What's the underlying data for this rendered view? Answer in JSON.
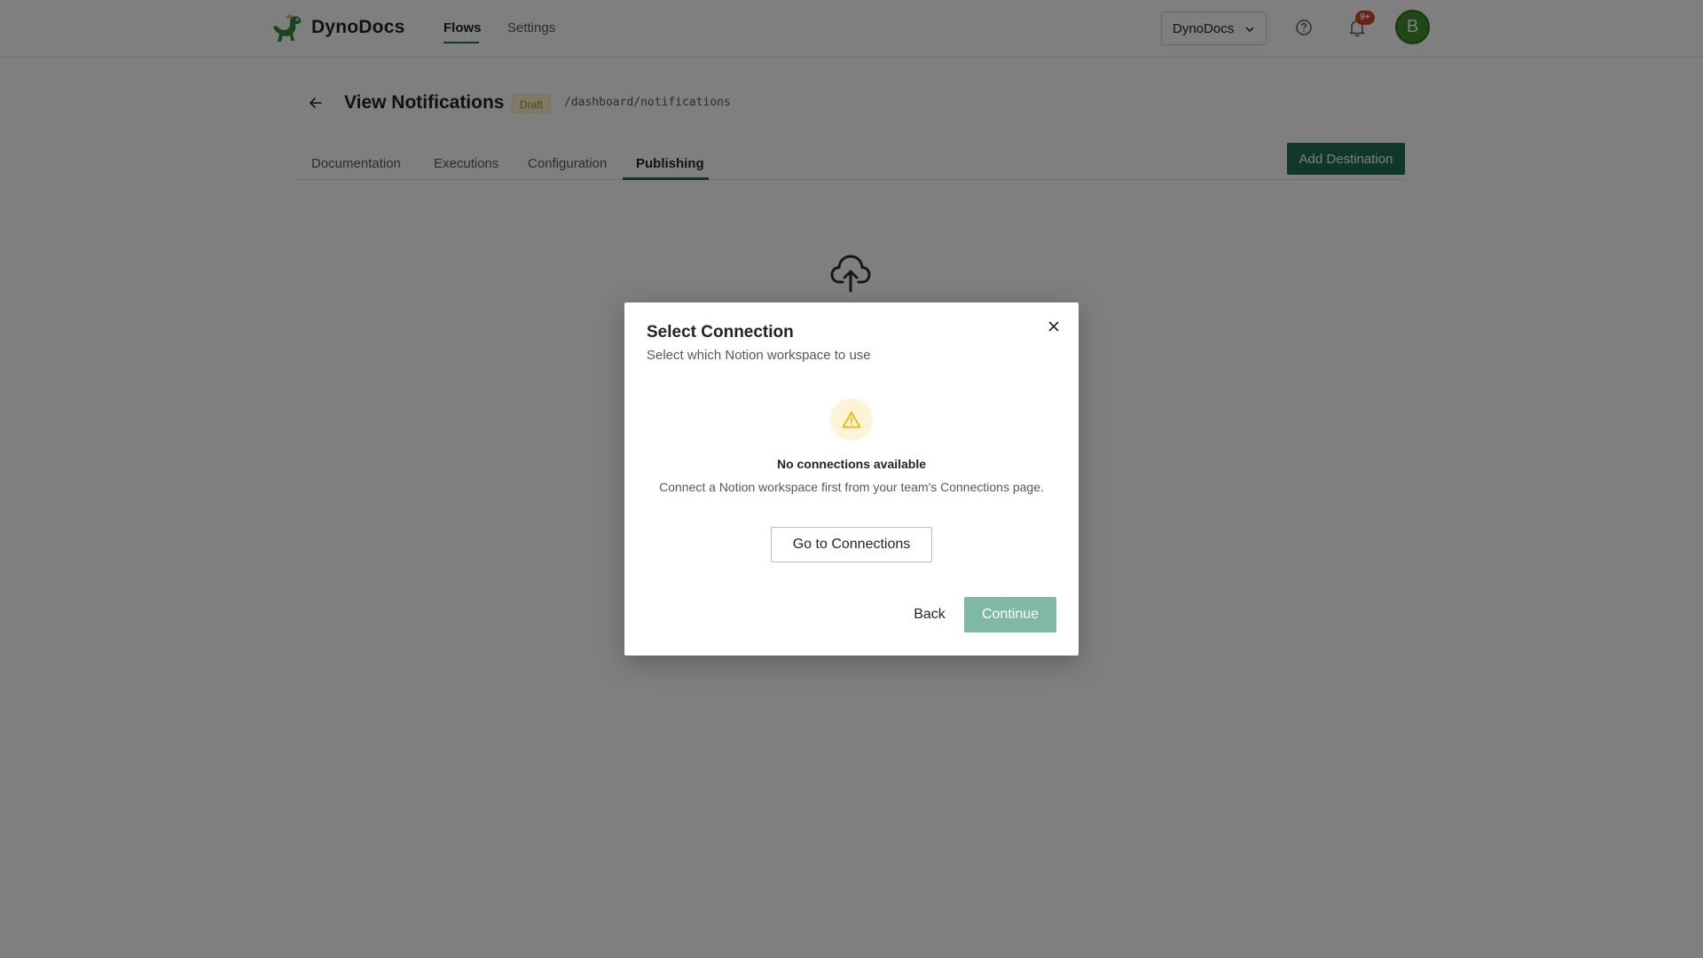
{
  "app": {
    "brand": "DynoDocs",
    "logo_icon": "dinosaur-logo-icon"
  },
  "nav": {
    "items": [
      {
        "label": "Flows",
        "active": true
      },
      {
        "label": "Settings",
        "active": false
      }
    ]
  },
  "header_right": {
    "workspace": "DynoDocs",
    "help_icon": "help-circle-icon",
    "bell_icon": "bell-icon",
    "notification_count": "9+",
    "avatar_initial": "B"
  },
  "page": {
    "title": "View Notifications",
    "status": "Draft",
    "path": "/dashboard/notifications"
  },
  "tabs": [
    {
      "label": "Documentation",
      "active": false
    },
    {
      "label": "Executions",
      "active": false
    },
    {
      "label": "Configuration",
      "active": false
    },
    {
      "label": "Publishing",
      "active": true
    }
  ],
  "actions": {
    "add_destination": "Add Destination"
  },
  "colors": {
    "accent": "#1f6e55",
    "continue_disabled": "#7fb9a6",
    "badge_red": "#d6452d",
    "avatar_green": "#3e8e2e",
    "warning": "#f4b400"
  },
  "modal": {
    "title": "Select Connection",
    "subtitle": "Select which Notion workspace to use",
    "empty_title": "No connections available",
    "empty_description": "Connect a Notion workspace first from your team's Connections page.",
    "goto_label": "Go to Connections",
    "back_label": "Back",
    "continue_label": "Continue"
  }
}
